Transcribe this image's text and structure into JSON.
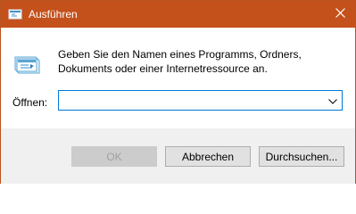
{
  "window": {
    "title": "Ausführen",
    "close_glyph": "✕"
  },
  "content": {
    "description": "Geben Sie den Namen eines Programms, Ordners, Dokuments oder einer Internetressource an.",
    "open_label": "Öffnen:",
    "open_value": ""
  },
  "buttons": {
    "ok": "OK",
    "cancel": "Abbrechen",
    "browse": "Durchsuchen..."
  },
  "colors": {
    "titlebar": "#c4501b",
    "accent": "#0078d7"
  },
  "icons": {
    "title": "run-icon",
    "app": "run-icon",
    "dropdown": "chevron-down-icon",
    "close": "close-icon"
  }
}
